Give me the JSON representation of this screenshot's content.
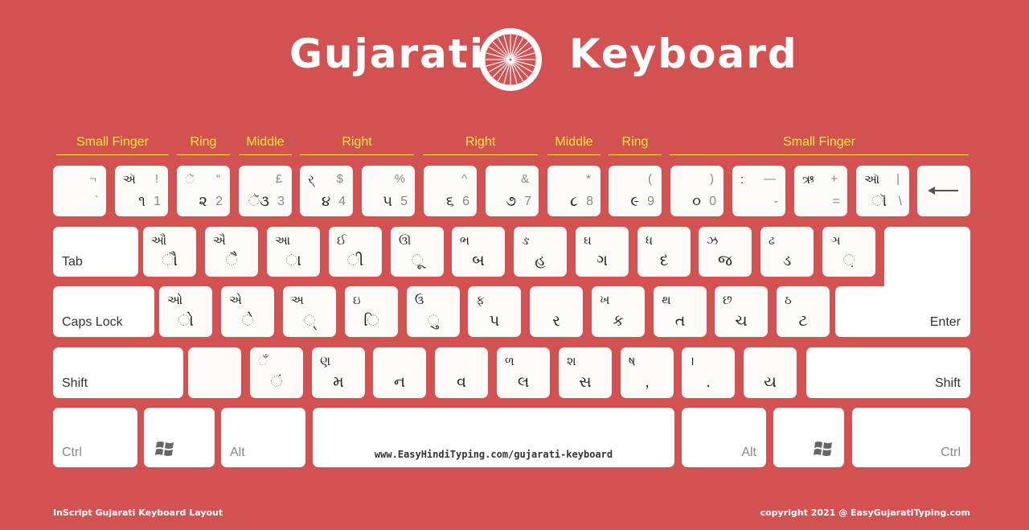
{
  "header": {
    "title_left": "Gujarati",
    "title_right": "Keyboard",
    "emblem_icon": "ashoka-chakra-icon"
  },
  "fingers": [
    {
      "label": "Small Finger"
    },
    {
      "label": "Ring"
    },
    {
      "label": "Middle"
    },
    {
      "label": "Right"
    },
    {
      "label": "Right"
    },
    {
      "label": "Middle"
    },
    {
      "label": "Ring"
    },
    {
      "label": "Small Finger"
    }
  ],
  "rows": {
    "number": [
      {
        "shift_guj": "",
        "shift_sym": "¬",
        "guj": "",
        "digit": "`"
      },
      {
        "shift_guj": "ઍ",
        "shift_sym": "!",
        "guj": "૧",
        "digit": "1"
      },
      {
        "shift_guj": "ૅ",
        "shift_sym": "“",
        "guj": "૨",
        "digit": "2"
      },
      {
        "shift_guj": "",
        "shift_sym": "£",
        "guj": "ૅ૩",
        "digit": "3"
      },
      {
        "shift_guj": "ર્",
        "shift_sym": "$",
        "guj": "૪",
        "digit": "4"
      },
      {
        "shift_guj": "",
        "shift_sym": "%",
        "guj": "૫",
        "digit": "5"
      },
      {
        "shift_guj": "",
        "shift_sym": "^",
        "guj": "૬",
        "digit": "6"
      },
      {
        "shift_guj": "",
        "shift_sym": "&",
        "guj": "૭",
        "digit": "7"
      },
      {
        "shift_guj": "",
        "shift_sym": "*",
        "guj": "૮",
        "digit": "8"
      },
      {
        "shift_guj": "",
        "shift_sym": "(",
        "guj": "૯",
        "digit": "9"
      },
      {
        "shift_guj": "",
        "shift_sym": ")",
        "guj": "૦",
        "digit": "0"
      },
      {
        "shift_guj": ":",
        "shift_sym": "—",
        "guj": "",
        "digit": "-"
      },
      {
        "shift_guj": "ઋ",
        "shift_sym": "+",
        "guj": "",
        "digit": "="
      },
      {
        "shift_guj": "ઑ",
        "shift_sym": "|",
        "guj": "ૉ",
        "digit": "\\"
      }
    ],
    "backspace_icon": "backspace-arrow-icon",
    "top": [
      {
        "upper": "ઔ",
        "lower": "ૌ"
      },
      {
        "upper": "ઐ",
        "lower": "ૈ"
      },
      {
        "upper": "આ",
        "lower": "ા"
      },
      {
        "upper": "ઈ",
        "lower": "ી"
      },
      {
        "upper": "ઊ",
        "lower": "ૂ"
      },
      {
        "upper": "ભ",
        "lower": "બ"
      },
      {
        "upper": "ઙ",
        "lower": "હ"
      },
      {
        "upper": "ઘ",
        "lower": "ગ"
      },
      {
        "upper": "ધ",
        "lower": "દ"
      },
      {
        "upper": "ઝ",
        "lower": "જ"
      },
      {
        "upper": "ઢ",
        "lower": "ડ"
      },
      {
        "upper": "ઞ",
        "lower": "઼"
      }
    ],
    "home": [
      {
        "upper": "ઓ",
        "lower": "ો"
      },
      {
        "upper": "એ",
        "lower": "ે"
      },
      {
        "upper": "અ",
        "lower": "્"
      },
      {
        "upper": "ઇ",
        "lower": "િ"
      },
      {
        "upper": "ઉ",
        "lower": "ુ"
      },
      {
        "upper": "ફ",
        "lower": "પ"
      },
      {
        "upper": "",
        "lower": "ર"
      },
      {
        "upper": "ખ",
        "lower": "ક"
      },
      {
        "upper": "થ",
        "lower": "ત"
      },
      {
        "upper": "છ",
        "lower": "ચ"
      },
      {
        "upper": "ઠ",
        "lower": "ટ"
      }
    ],
    "bottom": [
      {
        "upper": "",
        "lower": ""
      },
      {
        "upper": "ઁ",
        "lower": "ં"
      },
      {
        "upper": "ણ",
        "lower": "મ"
      },
      {
        "upper": "",
        "lower": "ન"
      },
      {
        "upper": "",
        "lower": "વ"
      },
      {
        "upper": "ળ",
        "lower": "લ"
      },
      {
        "upper": "શ",
        "lower": "સ"
      },
      {
        "upper": "ષ",
        "lower": ","
      },
      {
        "upper": "।",
        "lower": "."
      },
      {
        "upper": "",
        "lower": "ય"
      }
    ]
  },
  "modifiers": {
    "tab": "Tab",
    "caps_lock": "Caps Lock",
    "enter": "Enter",
    "shift_left": "Shift",
    "shift_right": "Shift",
    "ctrl_left": "Ctrl",
    "ctrl_right": "Ctrl",
    "alt_left": "Alt",
    "alt_right": "Alt",
    "windows_icon": "windows-logo-icon"
  },
  "spacebar": {
    "url": "www.EasyHindiTyping.com/gujarati-keyboard"
  },
  "footer": {
    "left": "InScript Gujarati Keyboard Layout",
    "right": "copyright 2021 @ EasyGujaratiTyping.com"
  },
  "colors": {
    "background": "#d25151",
    "finger_labels": "#ffe93b",
    "key": "#fcfbfa"
  }
}
